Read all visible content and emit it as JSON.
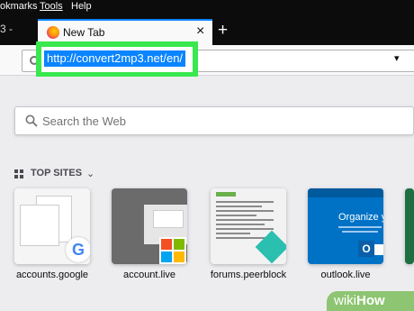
{
  "menubar": {
    "items": [
      "okmarks",
      "Tools",
      "Help"
    ]
  },
  "tabs": {
    "prev_tab_text": "3 -",
    "prev_tab_close": "×",
    "active_title": "New Tab",
    "active_close": "×",
    "new_tab": "+"
  },
  "urlbar": {
    "value": "http://convert2mp3.net/en/",
    "dropdown": "▾"
  },
  "search": {
    "placeholder": "Search the Web"
  },
  "top_sites": {
    "label": "TOP SITES",
    "chevron": "⌄",
    "sites": [
      {
        "label": "accounts.google",
        "icon": "google-icon"
      },
      {
        "label": "account.live",
        "icon": "microsoft-icon"
      },
      {
        "label": "forums.peerblock",
        "icon": "peerblock-icon"
      },
      {
        "label": "outlook.live",
        "icon": "outlook-icon"
      }
    ],
    "outlook_preview_heading": "Organize you"
  },
  "colors": {
    "highlight": "#39e84f",
    "selection": "#0a84ff",
    "tab_accent": "#0a84ff"
  },
  "watermark": {
    "wiki": "wiki",
    "how": "How"
  }
}
